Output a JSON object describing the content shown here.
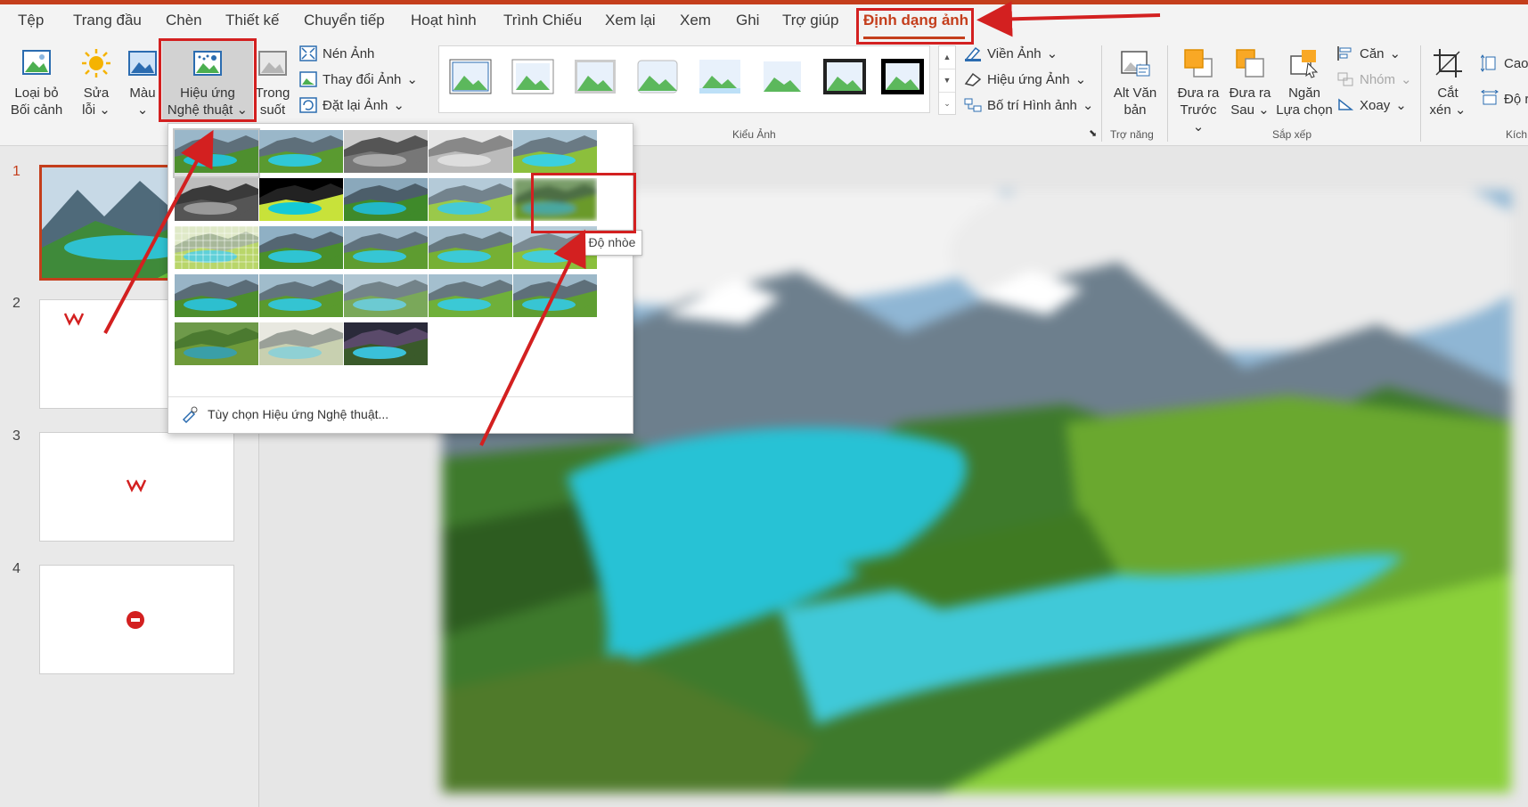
{
  "menu_tabs": [
    "Tệp",
    "Trang đầu",
    "Chèn",
    "Thiết kế",
    "Chuyển tiếp",
    "Hoạt hình",
    "Trình Chiếu",
    "Xem lại",
    "Xem",
    "Ghi",
    "Trợ giúp",
    "Định dạng ảnh"
  ],
  "active_tab_index": 11,
  "ribbon": {
    "remove_bg": [
      "Loại bỏ",
      "Bối cảnh"
    ],
    "corrections": [
      "Sửa",
      "lỗi"
    ],
    "color": [
      "Màu"
    ],
    "artistic_effects": [
      "Hiệu ứng",
      "Nghệ thuật"
    ],
    "transparency": [
      "Trong",
      "suốt"
    ],
    "compress": "Nén Ảnh",
    "change_picture": "Thay đổi Ảnh",
    "reset_picture": "Đặt lại Ảnh",
    "picture_border": "Viền Ảnh",
    "picture_effects": "Hiệu ứng Ảnh",
    "picture_layout": "Bố trí Hình ảnh",
    "picture_styles_label": "Kiểu Ảnh",
    "alt_text": [
      "Alt Văn",
      "bản"
    ],
    "accessibility_label": "Trợ năng",
    "bring_forward": [
      "Đưa ra",
      "Trước"
    ],
    "send_backward": [
      "Đưa ra",
      "Sau"
    ],
    "selection_pane": [
      "Ngăn",
      "Lựa chọn"
    ],
    "align": "Căn",
    "group": "Nhóm",
    "rotate": "Xoay",
    "arrange_label": "Sắp xếp",
    "crop": [
      "Cắt",
      "xén"
    ],
    "height": "Cao",
    "width": "Độ r",
    "size_label": "Kích"
  },
  "slides": [
    "1",
    "2",
    "3",
    "4"
  ],
  "selected_slide": 1,
  "artistic_menu": {
    "option": "Tùy chọn Hiệu ứng Nghệ thuật...",
    "tooltip": "Độ nhòe"
  },
  "colors": {
    "accent": "#c43e1c",
    "highlight": "#d32020",
    "ribbon_bg": "#f3f3f3"
  }
}
